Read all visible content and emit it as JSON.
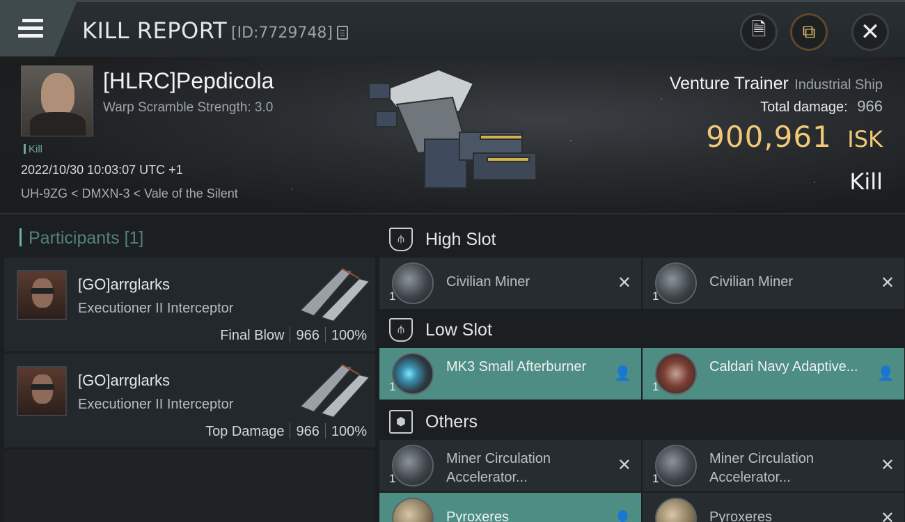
{
  "header": {
    "title": "KILL REPORT",
    "report_id": "[ID:7729748]",
    "buttons": {
      "doc": "🗎",
      "share": "⧉",
      "close": "✕"
    }
  },
  "victim": {
    "name": "[HLRC]Pepdicola",
    "warp_scramble": "Warp Scramble Strength: 3.0",
    "tag": "Kill",
    "datetime": "2022/10/30 10:03:07 UTC +1",
    "location": "UH-9ZG < DMXN-3 < Vale of the Silent"
  },
  "ship": {
    "name": "Venture Trainer",
    "class": "Industrial Ship",
    "total_damage_label": "Total damage:",
    "total_damage": "966",
    "isk_value": "900,961",
    "isk_unit": "ISK",
    "result": "Kill"
  },
  "participants": {
    "header": "Participants [1]",
    "items": [
      {
        "name": "[GO]arrglarks",
        "ship": "Executioner II Interceptor",
        "role": "Final Blow",
        "damage": "966",
        "percent": "100%"
      },
      {
        "name": "[GO]arrglarks",
        "ship": "Executioner II Interceptor",
        "role": "Top Damage",
        "damage": "966",
        "percent": "100%"
      }
    ]
  },
  "fitting": {
    "high_slot": {
      "title": "High Slot",
      "modules": [
        {
          "name": "Civilian Miner",
          "qty": "1",
          "state": "✕"
        },
        {
          "name": "Civilian Miner",
          "qty": "1",
          "state": "✕"
        }
      ]
    },
    "low_slot": {
      "title": "Low Slot",
      "modules": [
        {
          "name": "MK3 Small Afterburner",
          "qty": "1",
          "state": "👤"
        },
        {
          "name": "Caldari Navy Adaptive...",
          "qty": "1",
          "state": "👤"
        }
      ]
    },
    "others": {
      "title": "Others",
      "modules": [
        {
          "name": "Miner Circulation Accelerator...",
          "qty": "1",
          "state": "✕"
        },
        {
          "name": "Miner Circulation Accelerator...",
          "qty": "1",
          "state": "✕"
        },
        {
          "name": "Pyroxeres",
          "qty": "",
          "state": "👤"
        },
        {
          "name": "Pyroxeres",
          "qty": "",
          "state": "✕"
        }
      ]
    }
  },
  "colors": {
    "accent": "#4e8d84",
    "isk": "#f2c878",
    "background": "#1b1f22"
  }
}
